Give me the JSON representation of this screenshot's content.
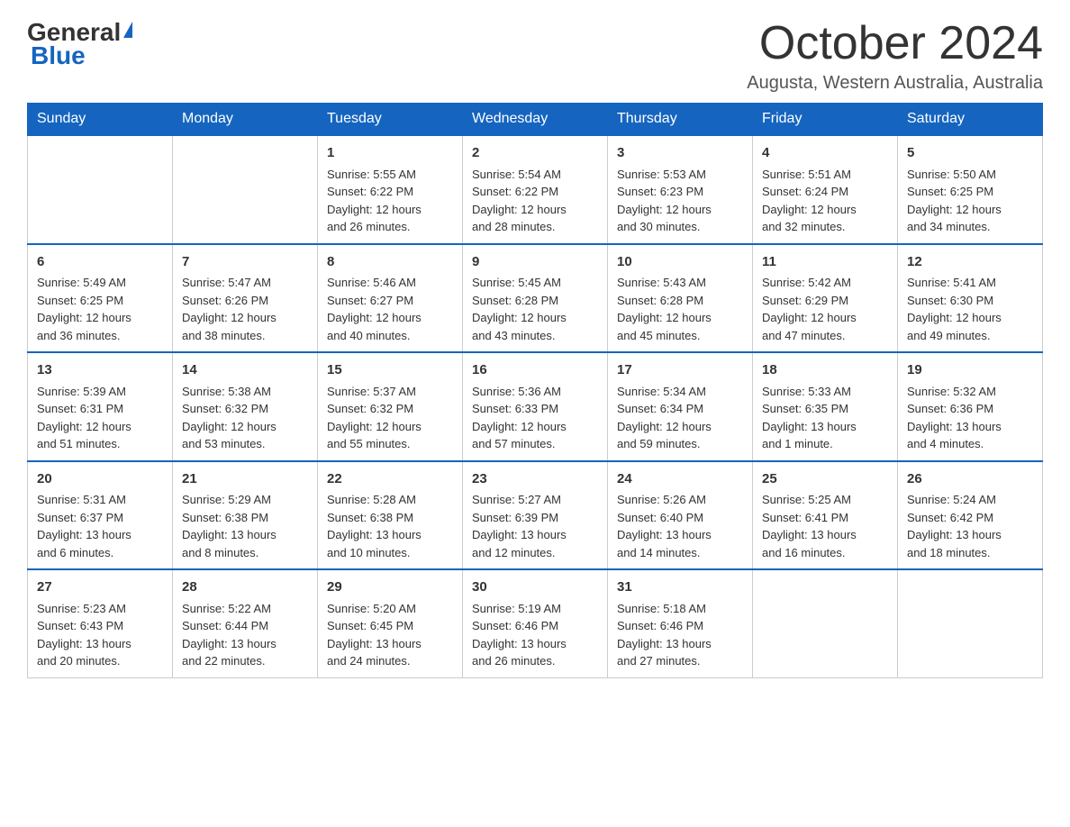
{
  "header": {
    "logo_general": "General",
    "logo_blue": "Blue",
    "month_title": "October 2024",
    "location": "Augusta, Western Australia, Australia"
  },
  "weekdays": [
    "Sunday",
    "Monday",
    "Tuesday",
    "Wednesday",
    "Thursday",
    "Friday",
    "Saturday"
  ],
  "weeks": [
    [
      {
        "day": "",
        "info": ""
      },
      {
        "day": "",
        "info": ""
      },
      {
        "day": "1",
        "info": "Sunrise: 5:55 AM\nSunset: 6:22 PM\nDaylight: 12 hours\nand 26 minutes."
      },
      {
        "day": "2",
        "info": "Sunrise: 5:54 AM\nSunset: 6:22 PM\nDaylight: 12 hours\nand 28 minutes."
      },
      {
        "day": "3",
        "info": "Sunrise: 5:53 AM\nSunset: 6:23 PM\nDaylight: 12 hours\nand 30 minutes."
      },
      {
        "day": "4",
        "info": "Sunrise: 5:51 AM\nSunset: 6:24 PM\nDaylight: 12 hours\nand 32 minutes."
      },
      {
        "day": "5",
        "info": "Sunrise: 5:50 AM\nSunset: 6:25 PM\nDaylight: 12 hours\nand 34 minutes."
      }
    ],
    [
      {
        "day": "6",
        "info": "Sunrise: 5:49 AM\nSunset: 6:25 PM\nDaylight: 12 hours\nand 36 minutes."
      },
      {
        "day": "7",
        "info": "Sunrise: 5:47 AM\nSunset: 6:26 PM\nDaylight: 12 hours\nand 38 minutes."
      },
      {
        "day": "8",
        "info": "Sunrise: 5:46 AM\nSunset: 6:27 PM\nDaylight: 12 hours\nand 40 minutes."
      },
      {
        "day": "9",
        "info": "Sunrise: 5:45 AM\nSunset: 6:28 PM\nDaylight: 12 hours\nand 43 minutes."
      },
      {
        "day": "10",
        "info": "Sunrise: 5:43 AM\nSunset: 6:28 PM\nDaylight: 12 hours\nand 45 minutes."
      },
      {
        "day": "11",
        "info": "Sunrise: 5:42 AM\nSunset: 6:29 PM\nDaylight: 12 hours\nand 47 minutes."
      },
      {
        "day": "12",
        "info": "Sunrise: 5:41 AM\nSunset: 6:30 PM\nDaylight: 12 hours\nand 49 minutes."
      }
    ],
    [
      {
        "day": "13",
        "info": "Sunrise: 5:39 AM\nSunset: 6:31 PM\nDaylight: 12 hours\nand 51 minutes."
      },
      {
        "day": "14",
        "info": "Sunrise: 5:38 AM\nSunset: 6:32 PM\nDaylight: 12 hours\nand 53 minutes."
      },
      {
        "day": "15",
        "info": "Sunrise: 5:37 AM\nSunset: 6:32 PM\nDaylight: 12 hours\nand 55 minutes."
      },
      {
        "day": "16",
        "info": "Sunrise: 5:36 AM\nSunset: 6:33 PM\nDaylight: 12 hours\nand 57 minutes."
      },
      {
        "day": "17",
        "info": "Sunrise: 5:34 AM\nSunset: 6:34 PM\nDaylight: 12 hours\nand 59 minutes."
      },
      {
        "day": "18",
        "info": "Sunrise: 5:33 AM\nSunset: 6:35 PM\nDaylight: 13 hours\nand 1 minute."
      },
      {
        "day": "19",
        "info": "Sunrise: 5:32 AM\nSunset: 6:36 PM\nDaylight: 13 hours\nand 4 minutes."
      }
    ],
    [
      {
        "day": "20",
        "info": "Sunrise: 5:31 AM\nSunset: 6:37 PM\nDaylight: 13 hours\nand 6 minutes."
      },
      {
        "day": "21",
        "info": "Sunrise: 5:29 AM\nSunset: 6:38 PM\nDaylight: 13 hours\nand 8 minutes."
      },
      {
        "day": "22",
        "info": "Sunrise: 5:28 AM\nSunset: 6:38 PM\nDaylight: 13 hours\nand 10 minutes."
      },
      {
        "day": "23",
        "info": "Sunrise: 5:27 AM\nSunset: 6:39 PM\nDaylight: 13 hours\nand 12 minutes."
      },
      {
        "day": "24",
        "info": "Sunrise: 5:26 AM\nSunset: 6:40 PM\nDaylight: 13 hours\nand 14 minutes."
      },
      {
        "day": "25",
        "info": "Sunrise: 5:25 AM\nSunset: 6:41 PM\nDaylight: 13 hours\nand 16 minutes."
      },
      {
        "day": "26",
        "info": "Sunrise: 5:24 AM\nSunset: 6:42 PM\nDaylight: 13 hours\nand 18 minutes."
      }
    ],
    [
      {
        "day": "27",
        "info": "Sunrise: 5:23 AM\nSunset: 6:43 PM\nDaylight: 13 hours\nand 20 minutes."
      },
      {
        "day": "28",
        "info": "Sunrise: 5:22 AM\nSunset: 6:44 PM\nDaylight: 13 hours\nand 22 minutes."
      },
      {
        "day": "29",
        "info": "Sunrise: 5:20 AM\nSunset: 6:45 PM\nDaylight: 13 hours\nand 24 minutes."
      },
      {
        "day": "30",
        "info": "Sunrise: 5:19 AM\nSunset: 6:46 PM\nDaylight: 13 hours\nand 26 minutes."
      },
      {
        "day": "31",
        "info": "Sunrise: 5:18 AM\nSunset: 6:46 PM\nDaylight: 13 hours\nand 27 minutes."
      },
      {
        "day": "",
        "info": ""
      },
      {
        "day": "",
        "info": ""
      }
    ]
  ]
}
